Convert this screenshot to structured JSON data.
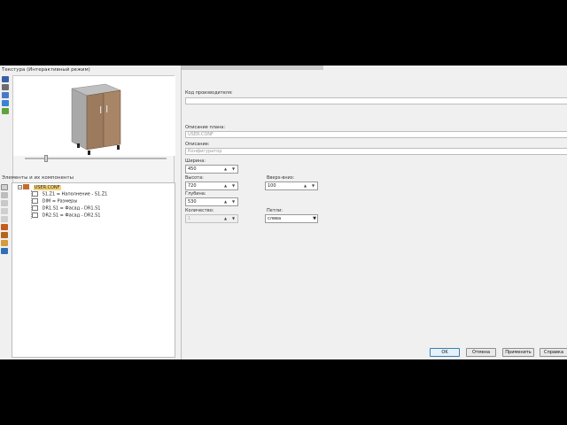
{
  "left": {
    "preview_title": "Текстура (Интерактивный режим)",
    "tree_title": "Элементы и их компоненты",
    "tree": [
      {
        "label": "USER.CONF",
        "level": 0,
        "selected": true,
        "expander": "−"
      },
      {
        "label": "S1.Z1 = Наполнение - S1.Z1",
        "level": 1
      },
      {
        "label": "DIM = Размеры",
        "level": 1
      },
      {
        "label": "DR1.S1 = Фасад - DR1.S1",
        "level": 1
      },
      {
        "label": "DR2.S1 = Фасад - DR2.S1",
        "level": 1
      }
    ],
    "slider": {
      "value": 0.15
    }
  },
  "form": {
    "manufacturer_code": {
      "label": "Код производителя:",
      "value": ""
    },
    "plan_desc": {
      "label": "Описание плана:",
      "value": "USER.CONF"
    },
    "desc": {
      "label": "Описание:",
      "value": "Конфигуратор"
    },
    "width": {
      "label": "Ширина:",
      "value": "450"
    },
    "height": {
      "label": "Высота:",
      "value": "720"
    },
    "depth": {
      "label": "Глубина:",
      "value": "530"
    },
    "quantity": {
      "label": "Количество:",
      "value": "1"
    },
    "top_bottom": {
      "label": "Вверх-вниз:",
      "value": "100"
    },
    "hinges": {
      "label": "Петли:",
      "value": "слева"
    }
  },
  "buttons": {
    "ok": "OK",
    "cancel": "Отмена",
    "apply": "Применить",
    "help": "Справка"
  },
  "colors": {
    "selection": "#f6d37a",
    "window_bg": "#f0f0f0",
    "cabinet_door": "#9c7a5d"
  }
}
